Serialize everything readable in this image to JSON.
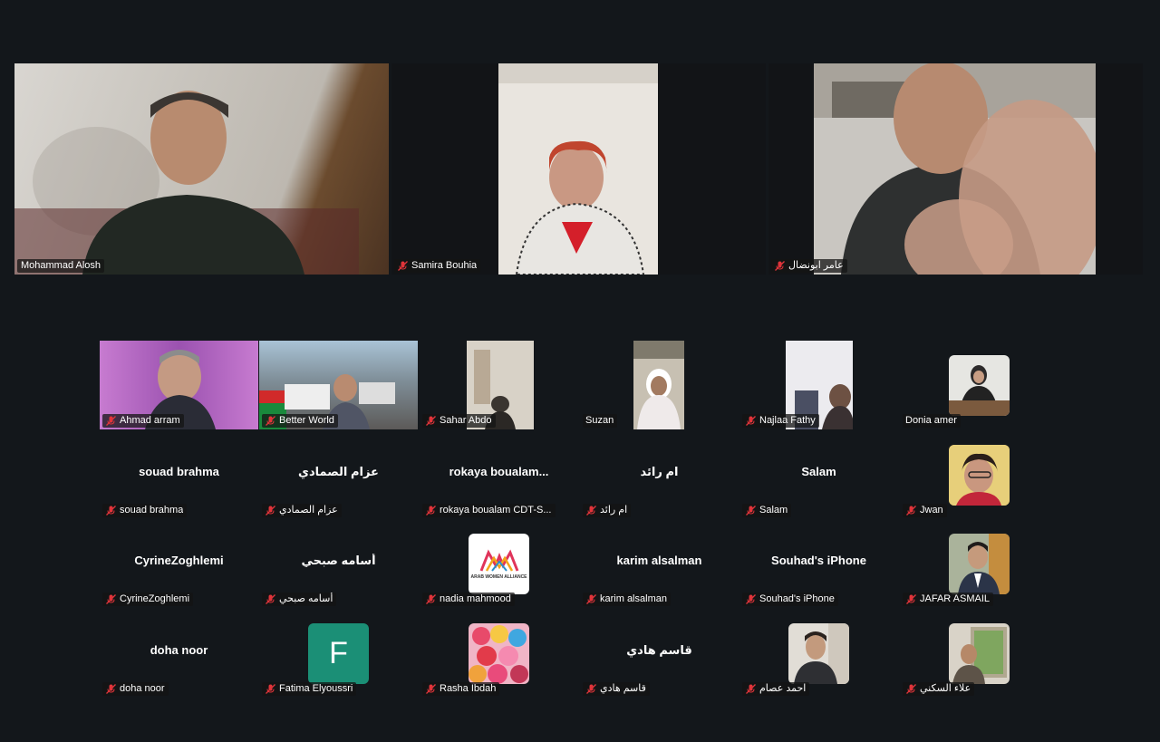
{
  "speakers": [
    {
      "name": "Mohammad Alosh",
      "active": true
    },
    {
      "name": "Samira Bouhia",
      "active": false
    },
    {
      "name": "عامر ابونضال",
      "active": false
    }
  ],
  "gallery": [
    {
      "label": "Ahmad arram"
    },
    {
      "label": "Better World"
    },
    {
      "label": "Sahar Abdo"
    },
    {
      "label": "Suzan"
    },
    {
      "label": "Najlaa Fathy"
    },
    {
      "label": "Donia amer"
    },
    {
      "label": "souad brahma",
      "center": "souad brahma"
    },
    {
      "label": "عزام الصمادي",
      "center": "عزام الصمادي"
    },
    {
      "label": "rokaya boualam CDT-S...",
      "center": "rokaya  boualam..."
    },
    {
      "label": "ام رائد",
      "center": "ام رائد"
    },
    {
      "label": "Salam",
      "center": "Salam"
    },
    {
      "label": "Jwan"
    },
    {
      "label": "CyrineZoghlemi",
      "center": "CyrineZoghlemi"
    },
    {
      "label": "أسامه صبحي",
      "center": "أسامه صبحي"
    },
    {
      "label": "nadia mahmood",
      "logo_text": "ARAB WOMEN ALLIANCE"
    },
    {
      "label": "karim alsalman",
      "center": "karim alsalman"
    },
    {
      "label": "Souhad's iPhone",
      "center": "Souhad's iPhone"
    },
    {
      "label": "JAFAR ASMAIL"
    },
    {
      "label": "doha noor",
      "center": "doha noor"
    },
    {
      "label": "Fatima Elyoussri",
      "initial": "F"
    },
    {
      "label": "Rasha Ibdah"
    },
    {
      "label": "قاسم هادي",
      "center": "قاسم هادي"
    },
    {
      "label": "احمد عصام"
    },
    {
      "label": "علاء السكني"
    }
  ],
  "colors": {
    "active_speaker": "#23d96b",
    "muted_icon": "#e0343a",
    "background": "#13171b",
    "avatar_initial_bg": "#1b8f76"
  },
  "icons": {
    "muted": "mic-muted-icon"
  }
}
